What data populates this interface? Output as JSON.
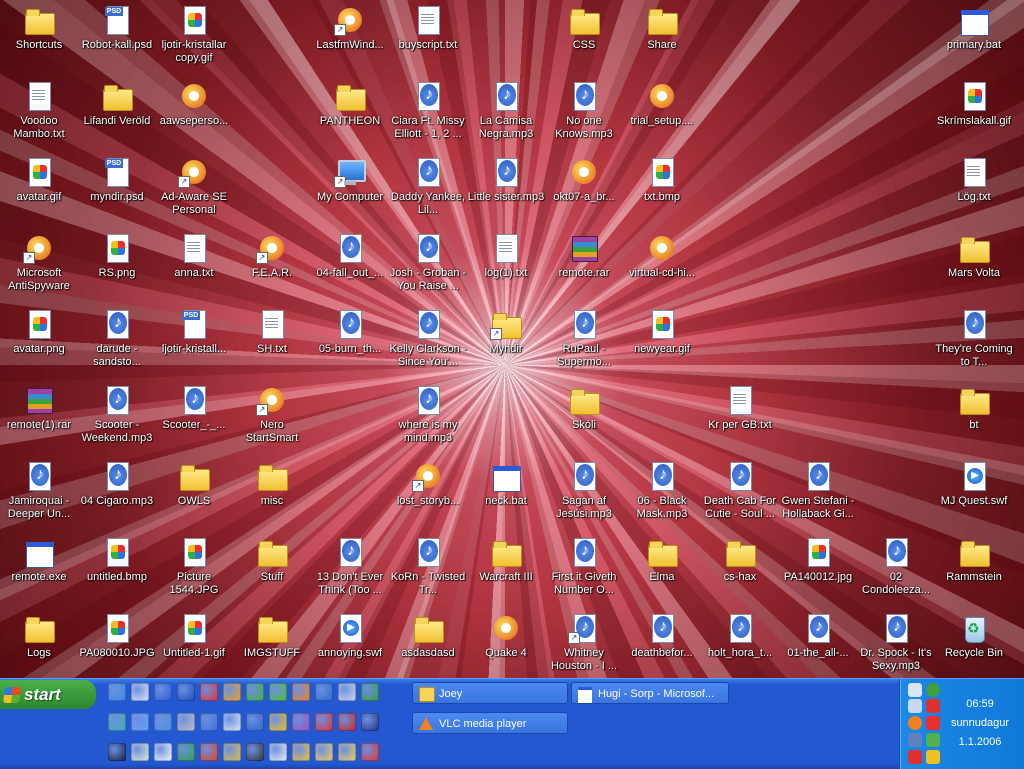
{
  "desktop": {
    "icons": [
      {
        "label": "Shortcuts",
        "type": "folder"
      },
      {
        "label": "Robot-kall.psd",
        "type": "psd"
      },
      {
        "label": "ljotir-kristallar copy.gif",
        "type": "image"
      },
      {
        "label": "LastfmWind...",
        "type": "app"
      },
      {
        "label": "buyscript.txt",
        "type": "doc"
      },
      {
        "label": "CSS",
        "type": "folder"
      },
      {
        "label": "Share",
        "type": "folder"
      },
      {
        "label": "primary.bat",
        "type": "exe"
      },
      {
        "label": "Voodoo Mambo.txt",
        "type": "doc"
      },
      {
        "label": "Lifandi Veröld",
        "type": "folder"
      },
      {
        "label": "aawseperso...",
        "type": "app"
      },
      {
        "label": "PANTHEON",
        "type": "folder"
      },
      {
        "label": "Ciara Ft. Missy Elliott - 1, 2 ...",
        "type": "audio"
      },
      {
        "label": "La Camisa Negra.mp3",
        "type": "audio"
      },
      {
        "label": "No one Knows.mp3",
        "type": "audio"
      },
      {
        "label": "trial_setup....",
        "type": "app"
      },
      {
        "label": "Skrímslakall.gif",
        "type": "image"
      },
      {
        "label": "avatar.gif",
        "type": "image"
      },
      {
        "label": "myndir.psd",
        "type": "psd"
      },
      {
        "label": "Ad-Aware SE Personal",
        "type": "app"
      },
      {
        "label": "My Computer",
        "type": "computer"
      },
      {
        "label": "Daddy Yankee, Lil...",
        "type": "audio"
      },
      {
        "label": "Little sister.mp3",
        "type": "audio"
      },
      {
        "label": "okt07-a_br...",
        "type": "app"
      },
      {
        "label": "txt.bmp",
        "type": "image"
      },
      {
        "label": "Lög.txt",
        "type": "doc"
      },
      {
        "label": "Microsoft AntiSpyware",
        "type": "app"
      },
      {
        "label": "RS.png",
        "type": "image"
      },
      {
        "label": "anna.txt",
        "type": "doc"
      },
      {
        "label": "F.E.A.R.",
        "type": "app"
      },
      {
        "label": "04-fall_out_...",
        "type": "audio"
      },
      {
        "label": "Josh - Groban - You Raise ...",
        "type": "audio"
      },
      {
        "label": "lög(1).txt",
        "type": "doc"
      },
      {
        "label": "remote.rar",
        "type": "archive"
      },
      {
        "label": "virtual-cd-hi...",
        "type": "app"
      },
      {
        "label": "Mars Volta",
        "type": "folder"
      },
      {
        "label": "avatar.png",
        "type": "image"
      },
      {
        "label": "darude - sandsto...",
        "type": "audio"
      },
      {
        "label": "ljotir-kristall...",
        "type": "psd"
      },
      {
        "label": "SH.txt",
        "type": "doc"
      },
      {
        "label": "05-burn_th...",
        "type": "audio"
      },
      {
        "label": "Kelly Clarkson - Since You'...",
        "type": "audio"
      },
      {
        "label": "Myndir",
        "type": "folder"
      },
      {
        "label": "RuPaul - Supermo...",
        "type": "audio"
      },
      {
        "label": "newyear.gif",
        "type": "image"
      },
      {
        "label": "They're Coming to T...",
        "type": "audio"
      },
      {
        "label": "remote(1).rar",
        "type": "archive"
      },
      {
        "label": "Scooter - Weekend.mp3",
        "type": "audio"
      },
      {
        "label": "Scooter_-_...",
        "type": "audio"
      },
      {
        "label": "Nero StartSmart",
        "type": "app"
      },
      {
        "label": "where is my mind.mp3",
        "type": "audio"
      },
      {
        "label": "Skóli",
        "type": "folder"
      },
      {
        "label": "Kr per GB.txt",
        "type": "doc"
      },
      {
        "label": "bt",
        "type": "folder"
      },
      {
        "label": "Jamiroquai - Deeper Un...",
        "type": "audio"
      },
      {
        "label": "04 Cigaro.mp3",
        "type": "audio"
      },
      {
        "label": "OWLS",
        "type": "folder"
      },
      {
        "label": "misc",
        "type": "folder"
      },
      {
        "label": "lost_storyb...",
        "type": "app"
      },
      {
        "label": "neck.bat",
        "type": "exe"
      },
      {
        "label": "Sagan af Jesúsi.mp3",
        "type": "audio"
      },
      {
        "label": "06 - Black Mask.mp3",
        "type": "audio"
      },
      {
        "label": "Death Cab For Cutie - Soul ...",
        "type": "audio"
      },
      {
        "label": "Gwen Stefani - Hollaback Gi...",
        "type": "audio"
      },
      {
        "label": "MJ Quest.swf",
        "type": "swf"
      },
      {
        "label": "remote.exe",
        "type": "exe"
      },
      {
        "label": "untitled.bmp",
        "type": "image"
      },
      {
        "label": "Picture 1544.JPG",
        "type": "image"
      },
      {
        "label": "Stuff",
        "type": "folder"
      },
      {
        "label": "13 Don't Ever Think (Too ...",
        "type": "audio"
      },
      {
        "label": "KoRn - Twisted Tr...",
        "type": "audio"
      },
      {
        "label": "Warcraft III",
        "type": "folder"
      },
      {
        "label": "First it Giveth Number O...",
        "type": "audio"
      },
      {
        "label": "Elma",
        "type": "folder"
      },
      {
        "label": "cs-hax",
        "type": "folder"
      },
      {
        "label": "PA140012.jpg",
        "type": "image"
      },
      {
        "label": "02 Condoleeza...",
        "type": "audio"
      },
      {
        "label": "Rammstein",
        "type": "folder"
      },
      {
        "label": "Logs",
        "type": "folder"
      },
      {
        "label": "PA080010.JPG",
        "type": "image"
      },
      {
        "label": "Untitled-1.gif",
        "type": "image"
      },
      {
        "label": "IMGSTUFF",
        "type": "folder"
      },
      {
        "label": "annoying.swf",
        "type": "swf"
      },
      {
        "label": "asdasdasd",
        "type": "folder"
      },
      {
        "label": "Quake 4",
        "type": "app"
      },
      {
        "label": "Whitney Houston - I ...",
        "type": "audio"
      },
      {
        "label": "deathbefor...",
        "type": "audio"
      },
      {
        "label": "holt_hora_t...",
        "type": "audio"
      },
      {
        "label": "01-the_all-...",
        "type": "audio"
      },
      {
        "label": "Dr. Spock - It's Sexy.mp3",
        "type": "audio"
      },
      {
        "label": "Recycle Bin",
        "type": "recycle"
      }
    ]
  },
  "taskbar": {
    "start_label": "start",
    "tasks": [
      {
        "label": "Joey",
        "icon": "folder-icon"
      },
      {
        "label": "Hugi - Sorp - Microsof...",
        "icon": "browser-window-icon"
      },
      {
        "label": "VLC media player",
        "icon": "vlc-cone-icon"
      }
    ],
    "quick_launch_colors": [
      "#3a8ae8",
      "#e0e8f8",
      "#2a5ad8",
      "#1a4ac0",
      "#e83030",
      "#f0a020",
      "#40b040",
      "#50c030",
      "#f08020",
      "#2a6ad0",
      "#d0d8e8",
      "#30a040",
      "#40b0b0",
      "#60a0ff",
      "#4a90e0",
      "#c0c0c0",
      "#3a70e0",
      "#e0e8f0",
      "#2a60d0",
      "#f0c020",
      "#9a50c0",
      "#e03030",
      "#d02020",
      "#203080",
      "#101840",
      "#e0f0d0",
      "#ffffff",
      "#30a040",
      "#e04020",
      "#e0c040",
      "#303030",
      "#f0f0f0",
      "#f0c040",
      "#f0d060",
      "#f0d060",
      "#e03030"
    ],
    "clock": {
      "time": "06:59",
      "day": "sunnudagur",
      "date": "1.1.2006"
    }
  }
}
